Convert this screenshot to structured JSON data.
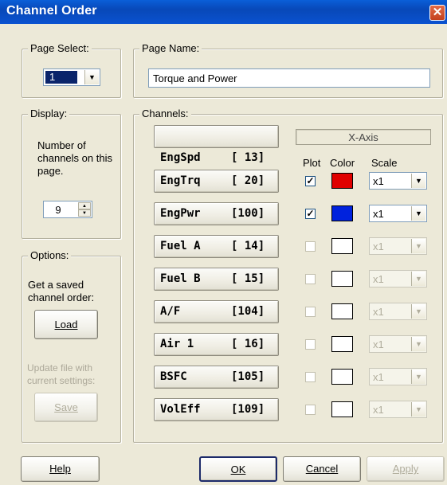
{
  "window": {
    "title": "Channel Order",
    "close_glyph": "✕"
  },
  "page_select": {
    "label": "Page Select:",
    "value": "1"
  },
  "page_name": {
    "label": "Page Name:",
    "value": "Torque and Power"
  },
  "display": {
    "label": "Display:",
    "text": "Number of channels on this page.",
    "count": "9"
  },
  "options": {
    "label": "Options:",
    "load_text": "Get a saved channel order:",
    "load_button": "Load",
    "update_text": "Update file with current settings:",
    "save_button": "Save"
  },
  "channels": {
    "label": "Channels:",
    "x_axis_label": "X-Axis",
    "col_plot": "Plot",
    "col_color": "Color",
    "col_scale": "Scale",
    "x_channel": {
      "name": "EngSpd",
      "num": "[ 13]"
    },
    "rows": [
      {
        "name": "EngTrq",
        "num": "[ 20]",
        "checked": true,
        "color": "#e00000",
        "scale": "x1",
        "enabled": true
      },
      {
        "name": "EngPwr",
        "num": "[100]",
        "checked": true,
        "color": "#0022dd",
        "scale": "x1",
        "enabled": true
      },
      {
        "name": "Fuel A",
        "num": "[ 14]",
        "checked": false,
        "color": "#ffffff",
        "scale": "x1",
        "enabled": false
      },
      {
        "name": "Fuel B",
        "num": "[ 15]",
        "checked": false,
        "color": "#ffffff",
        "scale": "x1",
        "enabled": false
      },
      {
        "name": "A/F",
        "num": "[104]",
        "checked": false,
        "color": "#ffffff",
        "scale": "x1",
        "enabled": false
      },
      {
        "name": "Air 1",
        "num": "[ 16]",
        "checked": false,
        "color": "#ffffff",
        "scale": "x1",
        "enabled": false
      },
      {
        "name": "BSFC",
        "num": "[105]",
        "checked": false,
        "color": "#ffffff",
        "scale": "x1",
        "enabled": false
      },
      {
        "name": "VolEff",
        "num": "[109]",
        "checked": false,
        "color": "#ffffff",
        "scale": "x1",
        "enabled": false
      }
    ]
  },
  "footer": {
    "help": "Help",
    "ok": "OK",
    "cancel": "Cancel",
    "apply": "Apply"
  }
}
